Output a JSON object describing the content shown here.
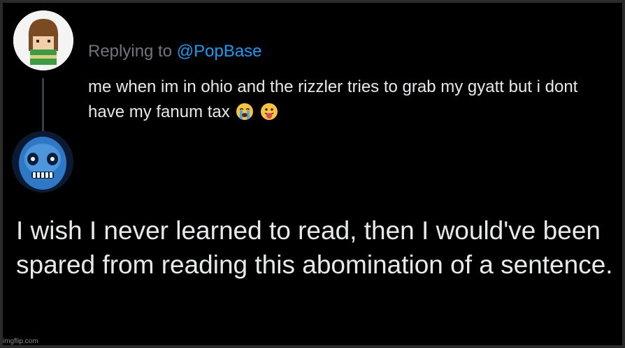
{
  "original_tweet": {
    "reply_prefix": "Replying to",
    "reply_handle": "@PopBase",
    "text": "me when im in ohio and the rizzler tries to grab my gyatt but i dont have my fanum tax",
    "emojis": [
      "loudly-crying-face",
      "face-with-tongue"
    ]
  },
  "reply_tweet": {
    "text": "I wish I never learned to read, then I would've been spared from reading this abomination of a sentence."
  },
  "watermark": "imgflip.com",
  "colors": {
    "background": "#000000",
    "text": "#e7e9ea",
    "muted": "#6f767d",
    "link": "#1d9bf0"
  }
}
